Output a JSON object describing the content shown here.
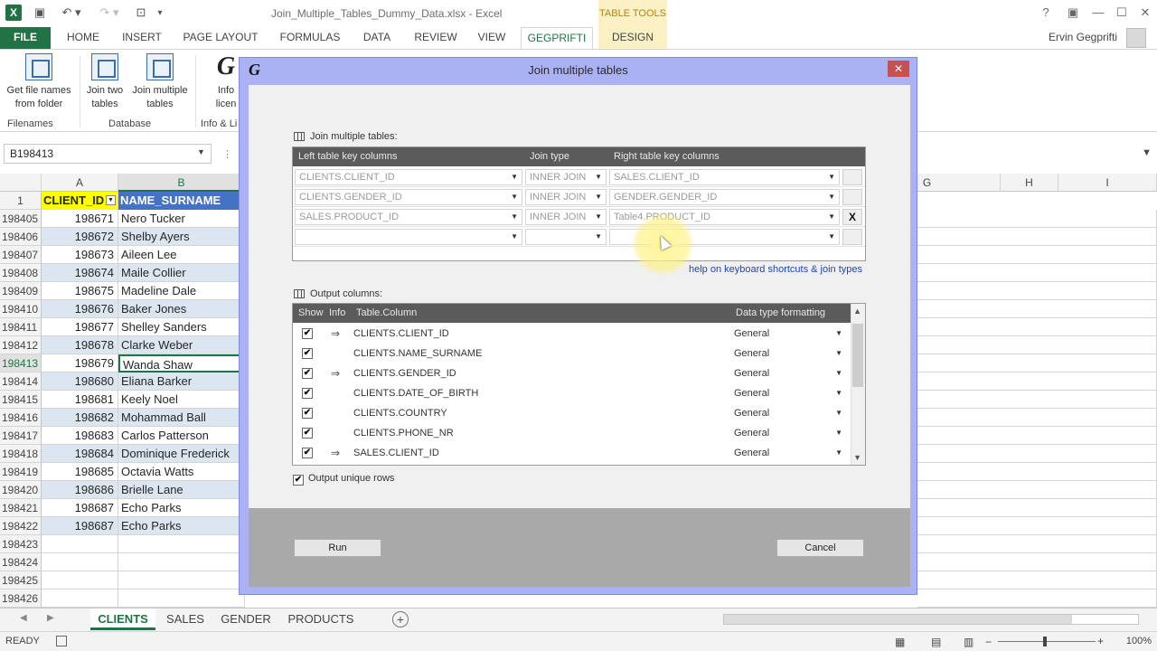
{
  "app": {
    "title": "Join_Multiple_Tables_Dummy_Data.xlsx - Excel",
    "context_tab_header": "TABLE TOOLS",
    "user": "Ervin Gegprifti",
    "brand_color": "#217346"
  },
  "ribbon": {
    "tabs": [
      "FILE",
      "HOME",
      "INSERT",
      "PAGE LAYOUT",
      "FORMULAS",
      "DATA",
      "REVIEW",
      "VIEW",
      "GEGPRIFTI",
      "DESIGN"
    ],
    "active_tab": "GEGPRIFTI",
    "buttons": {
      "file_names_1": "Get file names",
      "file_names_2": "from folder",
      "join_two_1": "Join two",
      "join_two_2": "tables",
      "join_multi_1": "Join multiple",
      "join_multi_2": "tables",
      "info_1": "Info",
      "info_2": "licen"
    },
    "groups": {
      "filenames": "Filenames",
      "database": "Database",
      "info": "Info & Li"
    }
  },
  "formula_bar": {
    "name_box": "B198413"
  },
  "grid": {
    "columns": [
      "A",
      "B",
      "G",
      "H",
      "I"
    ],
    "header_row_num": "1",
    "header_client_id": "CLIENT_ID",
    "header_name": "NAME_SURNAME",
    "rows": [
      {
        "r": "198405",
        "id": "198671",
        "name": "Nero Tucker"
      },
      {
        "r": "198406",
        "id": "198672",
        "name": "Shelby Ayers"
      },
      {
        "r": "198407",
        "id": "198673",
        "name": "Aileen Lee"
      },
      {
        "r": "198408",
        "id": "198674",
        "name": "Maile Collier"
      },
      {
        "r": "198409",
        "id": "198675",
        "name": "Madeline Dale"
      },
      {
        "r": "198410",
        "id": "198676",
        "name": "Baker Jones"
      },
      {
        "r": "198411",
        "id": "198677",
        "name": "Shelley Sanders"
      },
      {
        "r": "198412",
        "id": "198678",
        "name": "Clarke Weber"
      },
      {
        "r": "198413",
        "id": "198679",
        "name": "Wanda Shaw"
      },
      {
        "r": "198414",
        "id": "198680",
        "name": "Eliana Barker"
      },
      {
        "r": "198415",
        "id": "198681",
        "name": "Keely Noel"
      },
      {
        "r": "198416",
        "id": "198682",
        "name": "Mohammad Ball"
      },
      {
        "r": "198417",
        "id": "198683",
        "name": "Carlos Patterson"
      },
      {
        "r": "198418",
        "id": "198684",
        "name": "Dominique Frederick"
      },
      {
        "r": "198419",
        "id": "198685",
        "name": "Octavia Watts"
      },
      {
        "r": "198420",
        "id": "198686",
        "name": "Brielle Lane"
      },
      {
        "r": "198421",
        "id": "198687",
        "name": "Echo Parks"
      },
      {
        "r": "198422",
        "id": "198687",
        "name": "Echo Parks"
      },
      {
        "r": "198423",
        "id": "",
        "name": ""
      },
      {
        "r": "198424",
        "id": "",
        "name": ""
      },
      {
        "r": "198425",
        "id": "",
        "name": ""
      },
      {
        "r": "198426",
        "id": "",
        "name": ""
      }
    ],
    "selected_row": "198413"
  },
  "sheets": {
    "tabs": [
      "CLIENTS",
      "SALES",
      "GENDER",
      "PRODUCTS"
    ],
    "active": "CLIENTS"
  },
  "status": {
    "text": "READY",
    "zoom": "100%"
  },
  "dialog": {
    "title": "Join multiple tables",
    "logo": "G",
    "close": "✕",
    "join_section_label": "Join multiple tables:",
    "join_headers": {
      "left": "Left table key columns",
      "type": "Join type",
      "right": "Right table key columns"
    },
    "join_rows": [
      {
        "left": "CLIENTS.CLIENT_ID",
        "type": "INNER JOIN",
        "right": "SALES.CLIENT_ID",
        "del": ""
      },
      {
        "left": "CLIENTS.GENDER_ID",
        "type": "INNER JOIN",
        "right": "GENDER.GENDER_ID",
        "del": ""
      },
      {
        "left": "SALES.PRODUCT_ID",
        "type": "INNER JOIN",
        "right": "Table4.PRODUCT_ID",
        "del": "X"
      },
      {
        "left": "",
        "type": "",
        "right": "",
        "del": ""
      }
    ],
    "help_link": "help on keyboard shortcuts & join types",
    "output_section_label": "Output columns:",
    "output_headers": {
      "show": "Show",
      "info": "Info",
      "column": "Table.Column",
      "format": "Data type formatting"
    },
    "output_rows": [
      {
        "checked": "✔",
        "info": "⇒",
        "column": "CLIENTS.CLIENT_ID",
        "format": "General"
      },
      {
        "checked": "✔",
        "info": "",
        "column": "CLIENTS.NAME_SURNAME",
        "format": "General"
      },
      {
        "checked": "✔",
        "info": "⇒",
        "column": "CLIENTS.GENDER_ID",
        "format": "General"
      },
      {
        "checked": "✔",
        "info": "",
        "column": "CLIENTS.DATE_OF_BIRTH",
        "format": "General"
      },
      {
        "checked": "✔",
        "info": "",
        "column": "CLIENTS.COUNTRY",
        "format": "General"
      },
      {
        "checked": "✔",
        "info": "",
        "column": "CLIENTS.PHONE_NR",
        "format": "General"
      },
      {
        "checked": "✔",
        "info": "⇒",
        "column": "SALES.CLIENT_ID",
        "format": "General"
      }
    ],
    "unique_rows_label": "Output unique rows",
    "unique_checked": "✔",
    "run_label": "Run",
    "cancel_label": "Cancel"
  }
}
